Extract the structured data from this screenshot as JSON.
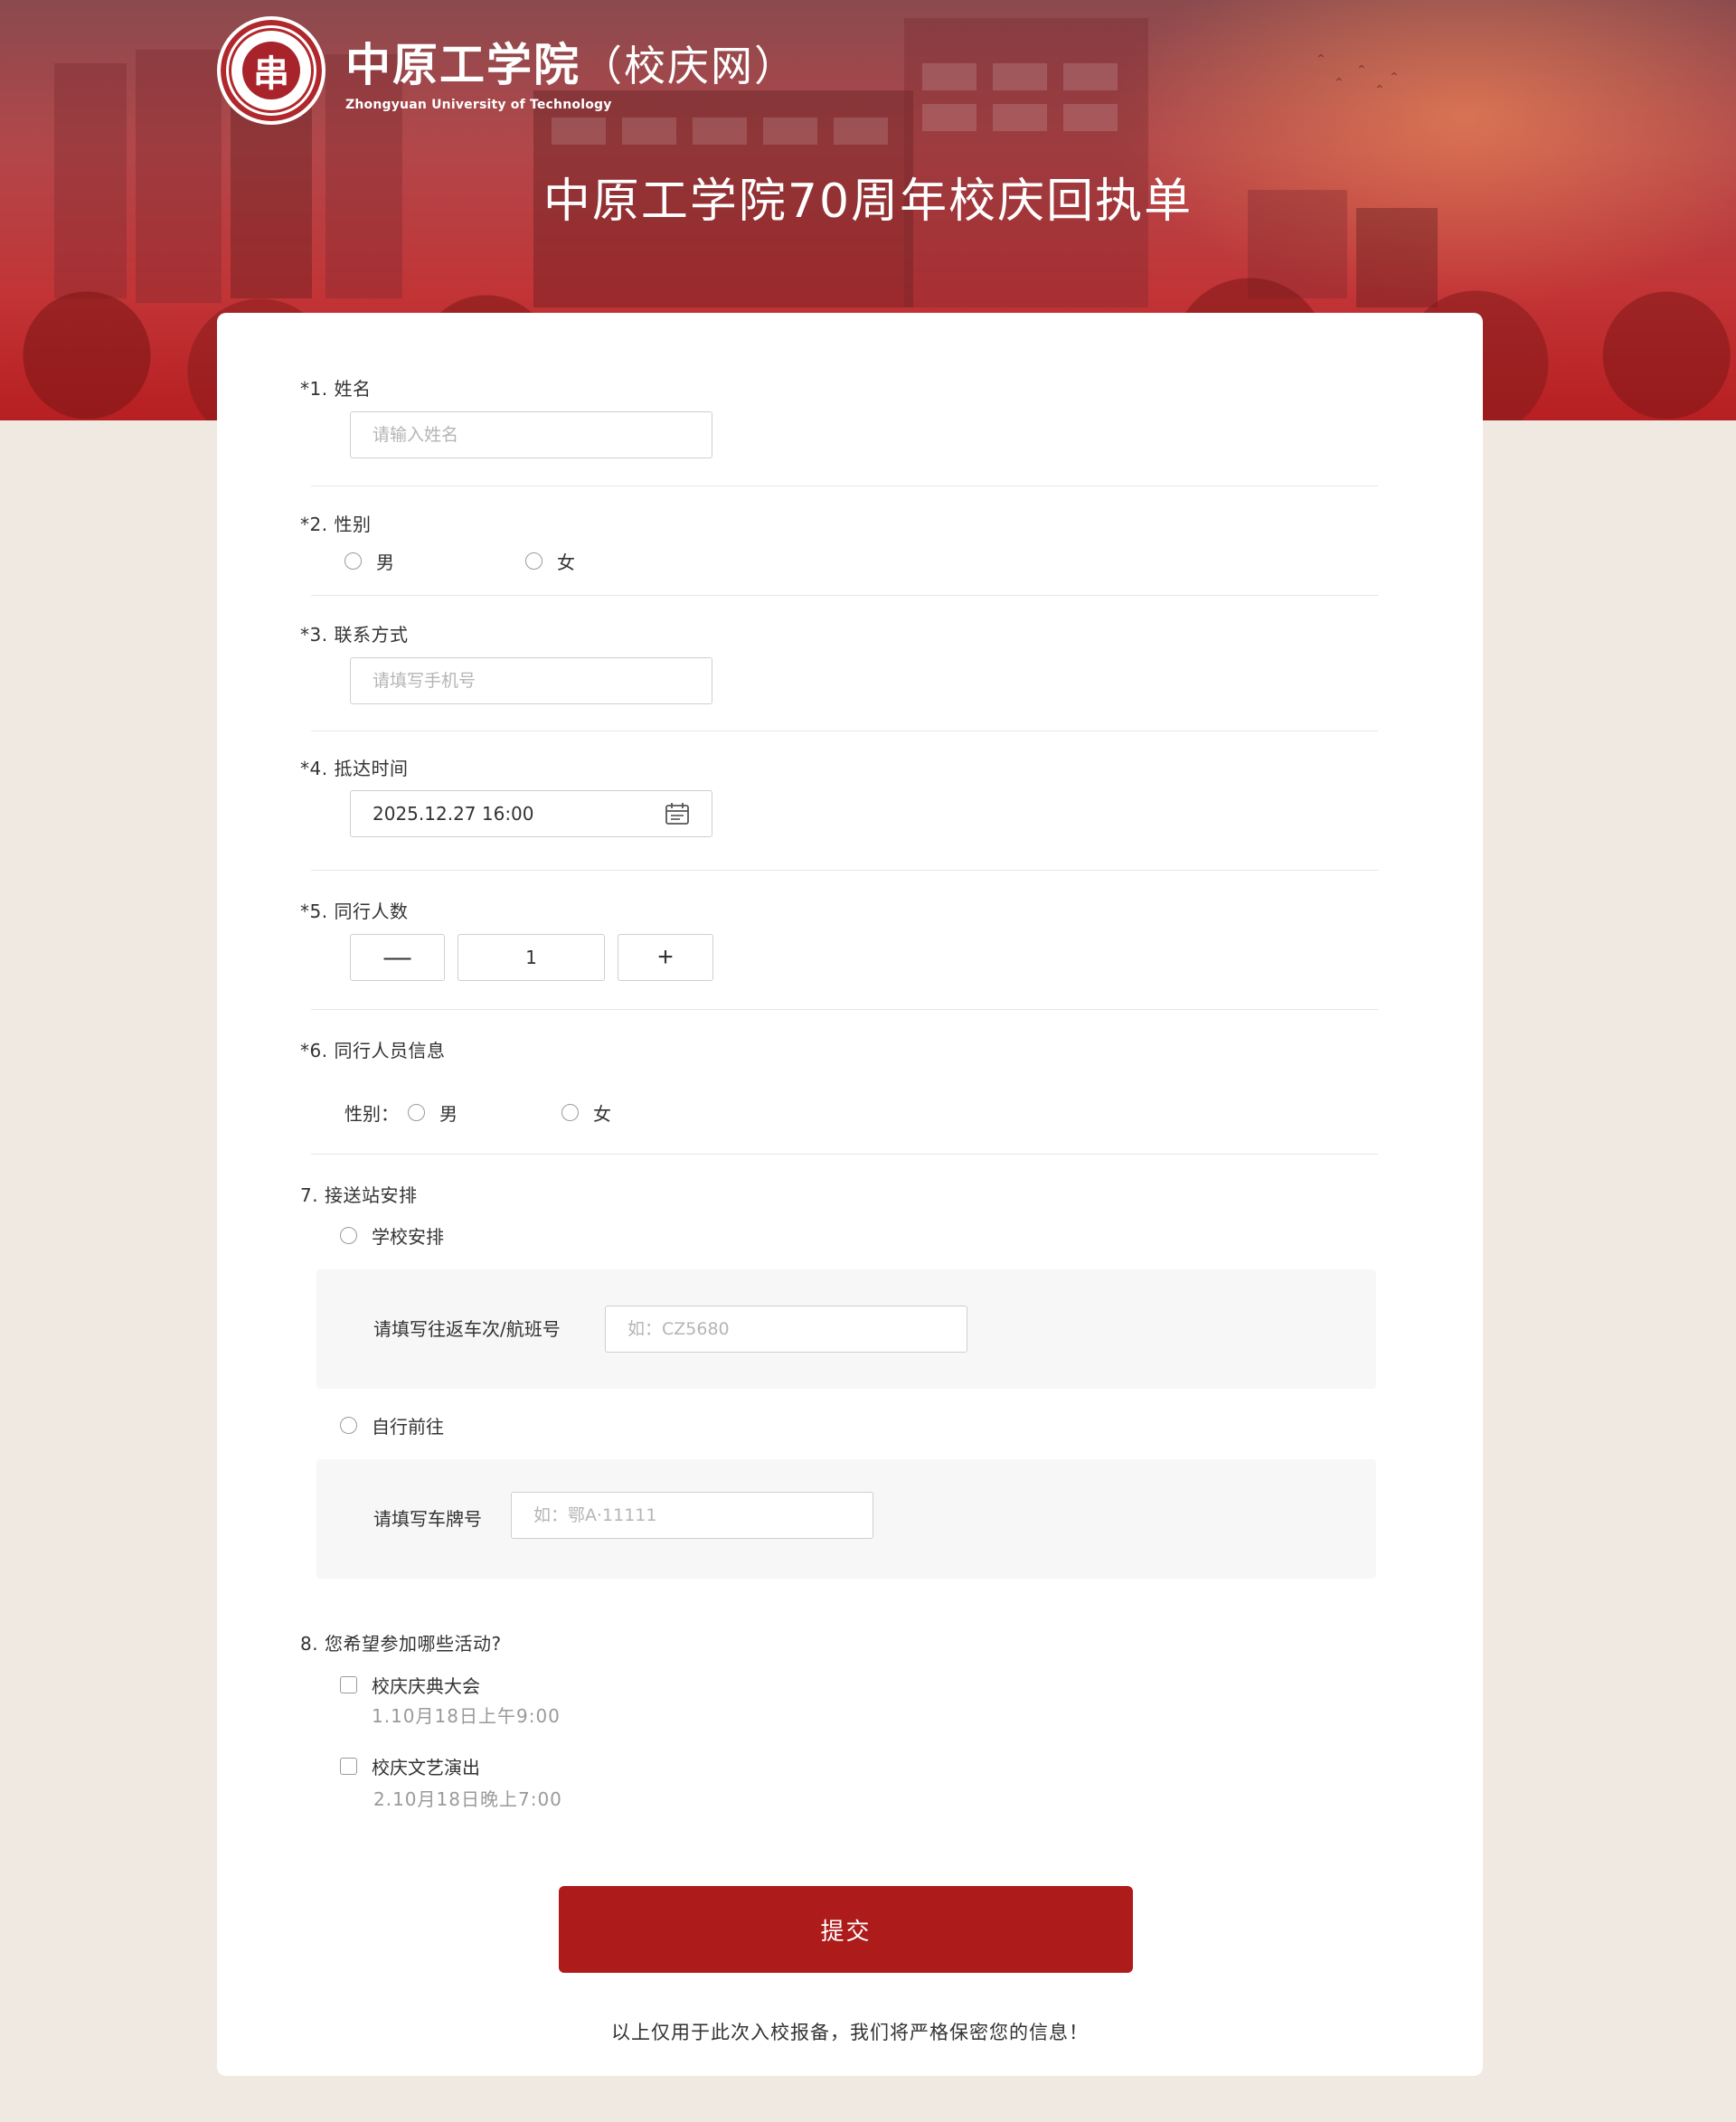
{
  "header": {
    "logo_cn": "中原工学院",
    "logo_cn_suffix": "（校庆网）",
    "logo_en": "Zhongyuan University of Technology",
    "logo_seal_char": "串",
    "title": "中原工学院70周年校庆回执单"
  },
  "colors": {
    "brand_red": "#ae1b1b",
    "page_bg": "#f0e9e2",
    "placeholder": "#b5b5b5"
  },
  "form": {
    "q1": {
      "title": "*1. 姓名",
      "placeholder": "请输入姓名",
      "value": ""
    },
    "q2": {
      "title": "*2. 性别",
      "options": [
        "男",
        "女"
      ]
    },
    "q3": {
      "title": "*3. 联系方式",
      "placeholder": "请填写手机号",
      "value": ""
    },
    "q4": {
      "title": "*4. 抵达时间",
      "value": "2025.12.27  16:00",
      "icon": "calendar-icon"
    },
    "q5": {
      "title": "*5. 同行人数",
      "minus": "—",
      "plus": "+",
      "value": "1"
    },
    "q6": {
      "title": "*6. 同行人员信息",
      "gender_label": "性别：",
      "options": [
        "男",
        "女"
      ]
    },
    "q7": {
      "title": "7. 接送站安排",
      "option_school": "学校安排",
      "school_label": "请填写往返车次/航班号",
      "school_placeholder": "如：CZ5680",
      "option_self": "自行前往",
      "self_label": "请填写车牌号",
      "self_placeholder": "如：鄂A·11111"
    },
    "q8": {
      "title": "8. 您希望参加哪些活动?",
      "activities": [
        {
          "name": "校庆庆典大会",
          "time": "1.10月18日上午9:00"
        },
        {
          "name": "校庆文艺演出",
          "time": "2.10月18日晚上7:00"
        }
      ]
    },
    "submit_label": "提交",
    "footer_note": "以上仅用于此次入校报备，我们将严格保密您的信息！"
  }
}
